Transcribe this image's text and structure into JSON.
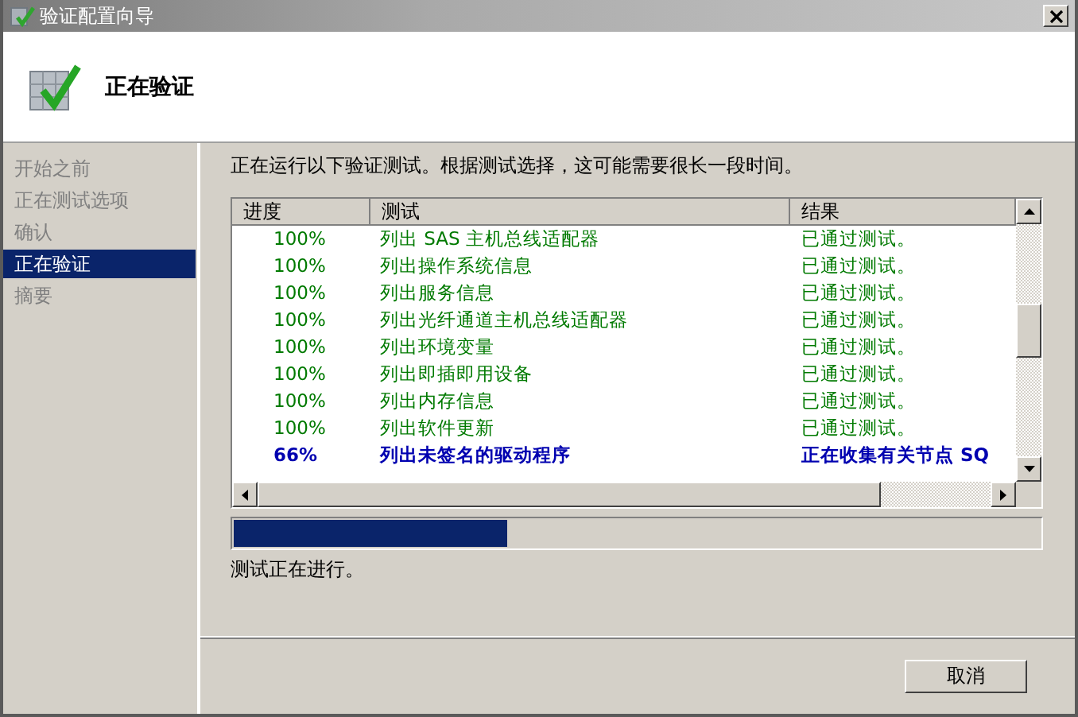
{
  "window": {
    "title": "验证配置向导"
  },
  "header": {
    "title": "正在验证"
  },
  "sidebar": {
    "items": [
      {
        "label": "开始之前",
        "selected": false
      },
      {
        "label": "正在测试选项",
        "selected": false
      },
      {
        "label": "确认",
        "selected": false
      },
      {
        "label": "正在验证",
        "selected": true
      },
      {
        "label": "摘要",
        "selected": false
      }
    ]
  },
  "intro": "正在运行以下验证测试。根据测试选择，这可能需要很长一段时间。",
  "table": {
    "columns": [
      "进度",
      "测试",
      "结果"
    ],
    "rows": [
      {
        "progress": "100%",
        "test": "列出 SAS 主机总线适配器",
        "result": "已通过测试。",
        "kind": "passed"
      },
      {
        "progress": "100%",
        "test": "列出操作系统信息",
        "result": "已通过测试。",
        "kind": "passed"
      },
      {
        "progress": "100%",
        "test": "列出服务信息",
        "result": "已通过测试。",
        "kind": "passed"
      },
      {
        "progress": "100%",
        "test": "列出光纤通道主机总线适配器",
        "result": "已通过测试。",
        "kind": "passed"
      },
      {
        "progress": "100%",
        "test": "列出环境变量",
        "result": "已通过测试。",
        "kind": "passed"
      },
      {
        "progress": "100%",
        "test": "列出即插即用设备",
        "result": "已通过测试。",
        "kind": "passed"
      },
      {
        "progress": "100%",
        "test": "列出内存信息",
        "result": "已通过测试。",
        "kind": "passed"
      },
      {
        "progress": "100%",
        "test": "列出软件更新",
        "result": "已通过测试。",
        "kind": "passed"
      },
      {
        "progress": "66%",
        "test": "列出未签名的驱动程序",
        "result": "正在收集有关节点 SQ",
        "kind": "running"
      }
    ]
  },
  "progress": {
    "level": 0.34
  },
  "status": "测试正在进行。",
  "buttons": [
    "取消"
  ]
}
